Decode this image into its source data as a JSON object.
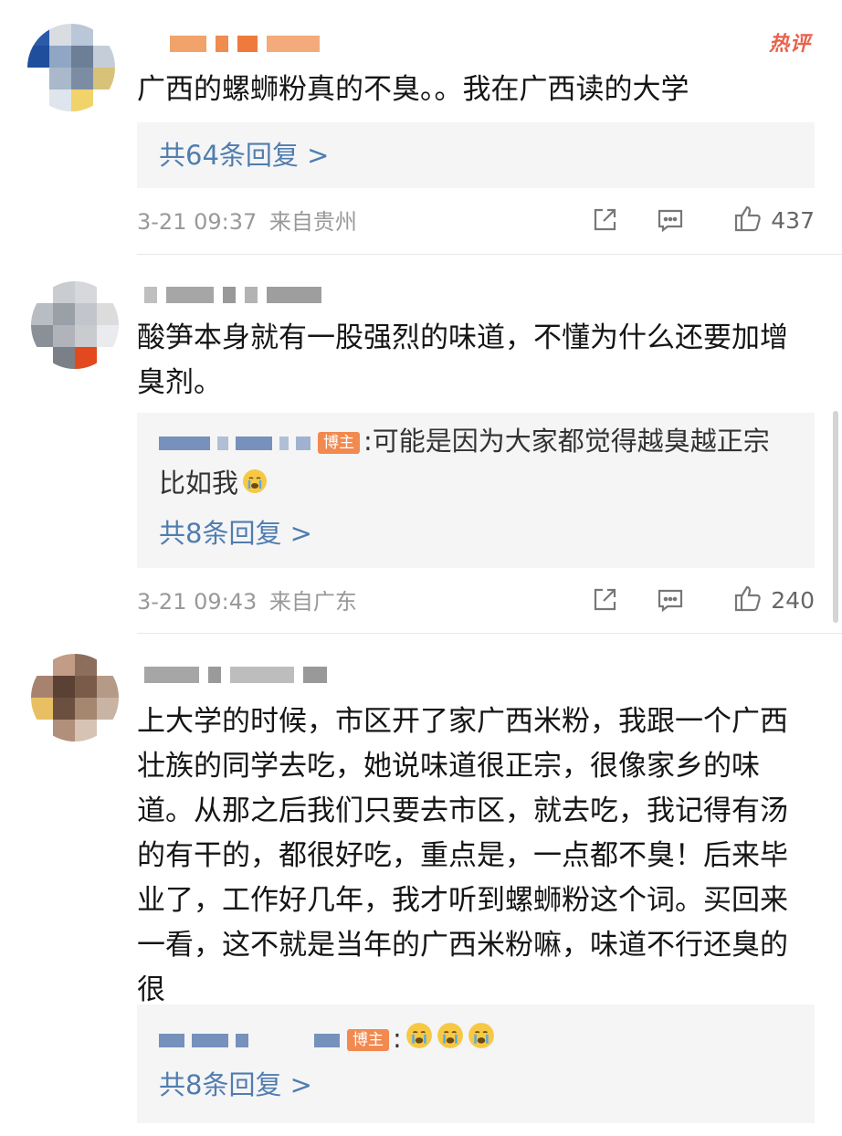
{
  "comments": [
    {
      "badge": "热评",
      "text": "广西的螺蛳粉真的不臭。。我在广西读的大学",
      "reply_count": "共64条回复 >",
      "time": "3-21 09:37",
      "source": "来自贵州",
      "likes": "437"
    },
    {
      "text": "酸笋本身就有一股强烈的味道，不懂为什么还要加增臭剂。",
      "reply": {
        "tag": "博主",
        "text": ":可能是因为大家都觉得越臭越正宗 比如我"
      },
      "reply_count": "共8条回复 >",
      "time": "3-21 09:43",
      "source": "来自广东",
      "likes": "240"
    },
    {
      "text": "上大学的时候，市区开了家广西米粉，我跟一个广西壮族的同学去吃，她说味道很正宗，很像家乡的味道。从那之后我们只要去市区，就去吃，我记得有汤的有干的，都很好吃，重点是，一点都不臭！后来毕业了，工作好几年，我才听到螺蛳粉这个词。买回来一看，这不就是当年的广西米粉嘛，味道不行还臭的很",
      "reply": {
        "tag": "博主",
        "text": ":"
      },
      "reply_count": "共8条回复 >"
    }
  ],
  "icons": {
    "share": "share-icon",
    "comment": "comment-icon",
    "like": "thumbs-up-icon",
    "emoji": "crying-face-icon"
  },
  "colors": {
    "link": "#507daf",
    "tag": "#f2894f",
    "hot": "#e8614a",
    "meta": "#999999"
  }
}
